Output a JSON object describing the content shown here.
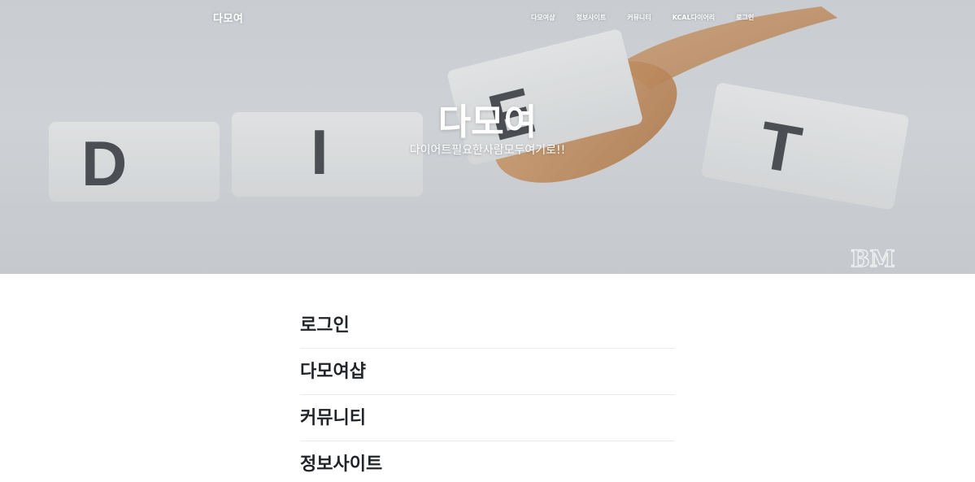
{
  "nav": {
    "brand": "다모여",
    "links": [
      "다모여샵",
      "정보사이트",
      "커뮤니티",
      "KCAL다이어리",
      "로그인"
    ]
  },
  "hero": {
    "title": "다모여",
    "subtitle": "다이어트필요한사람모두여기로!!",
    "image_letters": [
      "D",
      "I",
      "E",
      "T"
    ],
    "watermark": "BM"
  },
  "menu": {
    "items": [
      "로그인",
      "다모여샵",
      "커뮤니티",
      "정보사이트"
    ]
  },
  "colors": {
    "text": "#212529",
    "divider": "#e9ecef",
    "hero_text": "#ffffff"
  }
}
